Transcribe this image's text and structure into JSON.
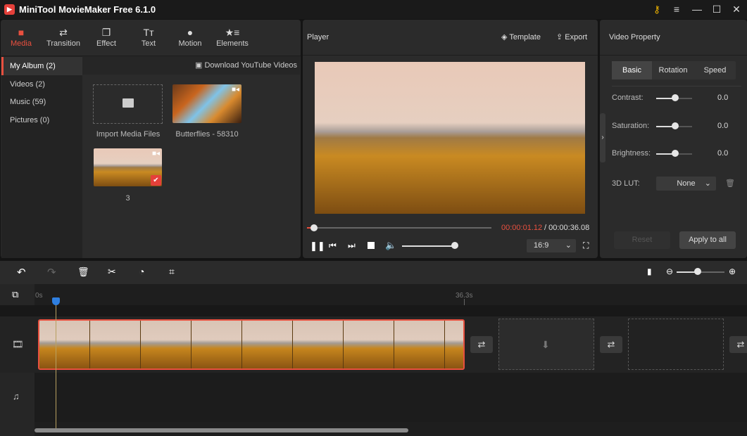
{
  "app": {
    "title": "MiniTool MovieMaker Free 6.1.0",
    "logo": "MiniTool logo"
  },
  "window_controls": [
    "key-icon",
    "menu-icon",
    "minimize-icon",
    "maximize-icon",
    "close-icon"
  ],
  "toolbar_tabs": [
    {
      "label": "Media",
      "icon": "folder-icon",
      "active": true
    },
    {
      "label": "Transition",
      "icon": "swap-icon"
    },
    {
      "label": "Effect",
      "icon": "layers-icon"
    },
    {
      "label": "Text",
      "icon": "text-icon"
    },
    {
      "label": "Motion",
      "icon": "motion-icon"
    },
    {
      "label": "Elements",
      "icon": "star-list-icon"
    }
  ],
  "sidebar": {
    "items": [
      {
        "label": "My Album (2)",
        "active": true
      },
      {
        "label": "Videos (2)"
      },
      {
        "label": "Music (59)"
      },
      {
        "label": "Pictures (0)"
      }
    ]
  },
  "media": {
    "download_label": "Download YouTube Videos",
    "items": [
      {
        "label": "Import Media Files"
      },
      {
        "label": "Butterflies - 58310"
      },
      {
        "label": "3"
      }
    ]
  },
  "player": {
    "title": "Player",
    "template_label": "Template",
    "export_label": "Export",
    "current_time": "00:00:01.12",
    "total_time": " / 00:00:36.08",
    "progress": 0.04,
    "volume": 0.9,
    "aspect": "16:9"
  },
  "properties": {
    "title": "Video Property",
    "tabs": [
      "Basic",
      "Rotation",
      "Speed"
    ],
    "active_tab": "Basic",
    "rows": [
      {
        "label": "Contrast:",
        "value": "0.0"
      },
      {
        "label": "Saturation:",
        "value": "0.0"
      },
      {
        "label": "Brightness:",
        "value": "0.0"
      }
    ],
    "lut_label": "3D LUT:",
    "lut_value": "None",
    "reset_label": "Reset",
    "apply_label": "Apply to all"
  },
  "timeline": {
    "ruler_start": "0s",
    "ruler_end": "36.3s",
    "zoom_level": 0.7
  },
  "colors": {
    "accent": "#e8503f",
    "playhead": "#2f7fe0"
  }
}
